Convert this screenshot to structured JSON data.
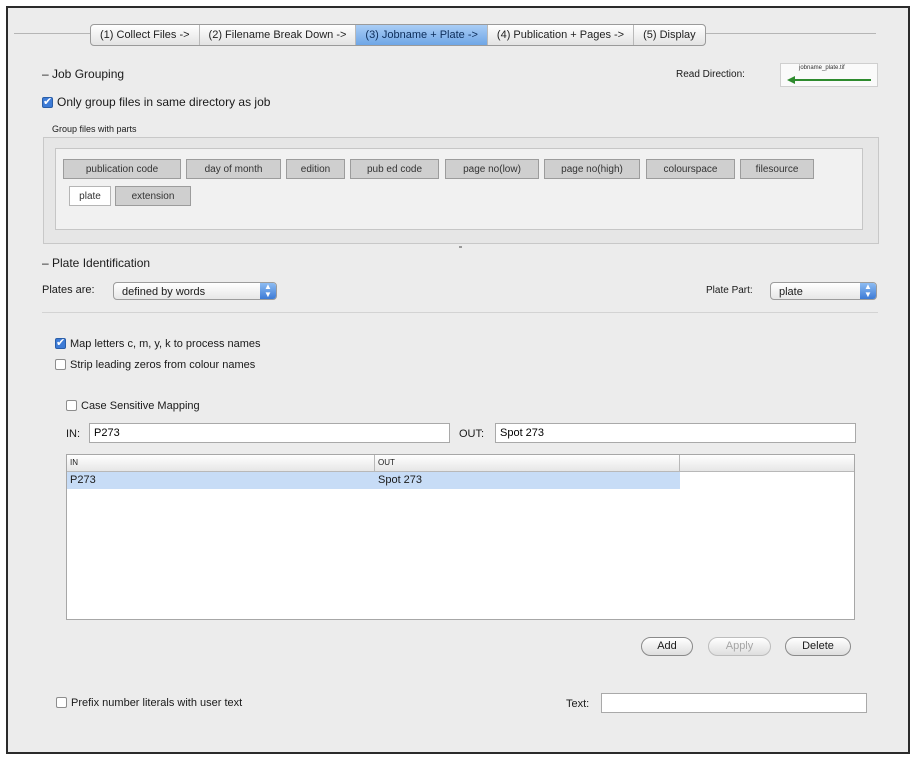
{
  "tabs": [
    {
      "label": "(1) Collect Files ->",
      "active": false
    },
    {
      "label": "(2) Filename Break Down ->",
      "active": false
    },
    {
      "label": "(3) Jobname + Plate ->",
      "active": true
    },
    {
      "label": "(4) Publication + Pages ->",
      "active": false
    },
    {
      "label": "(5) Display",
      "active": false
    }
  ],
  "job_grouping": {
    "title": "– Job Grouping",
    "read_direction_label": "Read Direction:",
    "read_direction_value": "jobname_plate.tif",
    "only_group_label": "Only group files in same directory as job",
    "only_group_checked": true,
    "group_files_label": "Group files with parts",
    "chips": [
      "publication code",
      "day of month",
      "edition",
      "pub ed code",
      "page no(low)",
      "page no(high)",
      "colourspace",
      "filesource",
      "plate",
      "extension"
    ]
  },
  "plate_identification": {
    "title": "– Plate Identification",
    "plates_are_label": "Plates are:",
    "plates_are_value": "defined by words",
    "plate_part_label": "Plate Part:",
    "plate_part_value": "plate",
    "map_letters_label": "Map letters c, m, y, k to process names",
    "map_letters_checked": true,
    "strip_zeros_label": "Strip leading zeros from colour names",
    "strip_zeros_checked": false,
    "case_sensitive_label": "Case Sensitive Mapping",
    "case_sensitive_checked": false,
    "in_label": "IN:",
    "in_value": "P273",
    "out_label": "OUT:",
    "out_value": "Spot 273"
  },
  "mapping_table": {
    "columns": [
      "IN",
      "OUT"
    ],
    "rows": [
      {
        "in": "P273",
        "out": "Spot 273"
      }
    ]
  },
  "buttons": {
    "add": "Add",
    "apply": "Apply",
    "delete": "Delete"
  },
  "prefix": {
    "label": "Prefix number literals with user text",
    "checked": false,
    "text_label": "Text:",
    "text_value": ""
  },
  "colors": {
    "accent": "#3d7bd6",
    "selection": "#c7dcf6",
    "arrow": "#2e8b2e"
  },
  "icons": {
    "checkbox": "checkmark",
    "popup": "up-down-arrows-icon",
    "read_direction": "left-arrow-icon"
  }
}
